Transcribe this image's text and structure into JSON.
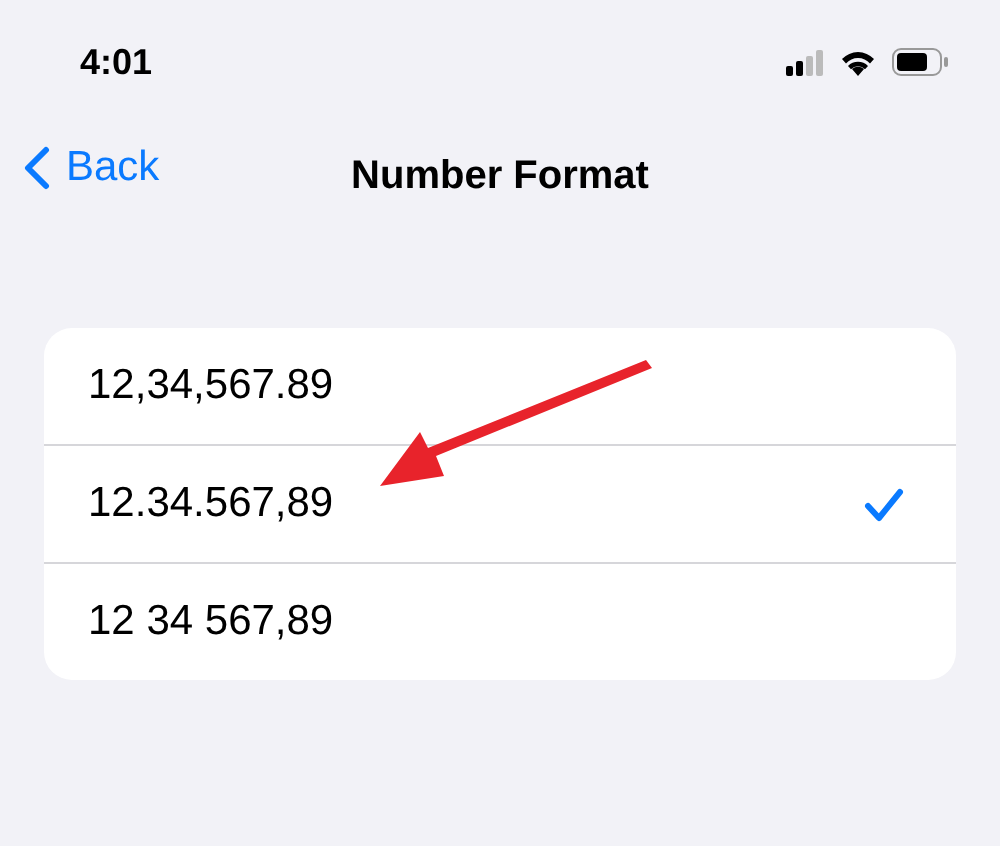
{
  "status_bar": {
    "time": "4:01"
  },
  "nav": {
    "back": "Back",
    "title": "Number Format"
  },
  "options": [
    {
      "label": "12,34,567.89",
      "selected": false
    },
    {
      "label": "12.34.567,89",
      "selected": true
    },
    {
      "label": "12 34 567,89",
      "selected": false
    }
  ]
}
